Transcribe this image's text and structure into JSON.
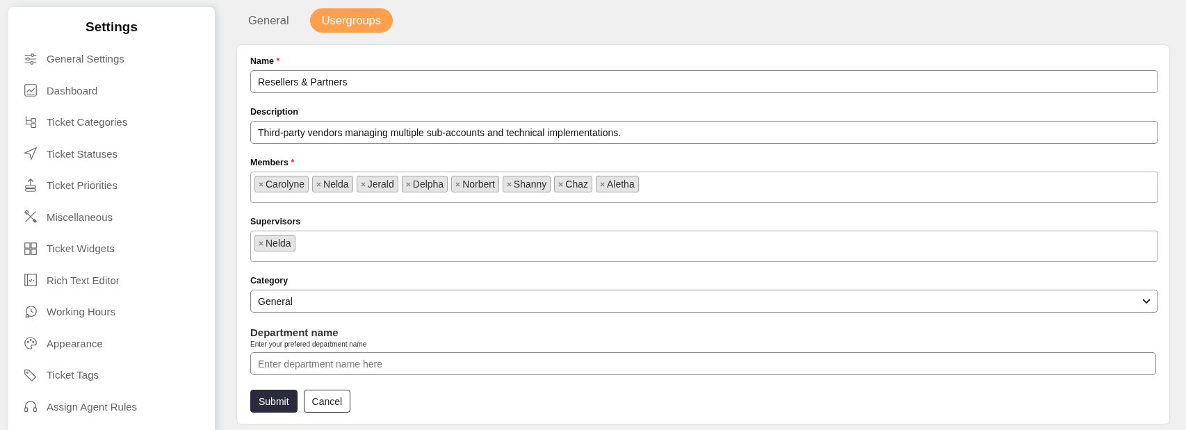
{
  "sidebar": {
    "title": "Settings",
    "items": [
      {
        "label": "General Settings"
      },
      {
        "label": "Dashboard"
      },
      {
        "label": "Ticket Categories"
      },
      {
        "label": "Ticket Statuses"
      },
      {
        "label": "Ticket Priorities"
      },
      {
        "label": "Miscellaneous"
      },
      {
        "label": "Ticket Widgets"
      },
      {
        "label": "Rich Text Editor"
      },
      {
        "label": "Working Hours"
      },
      {
        "label": "Appearance"
      },
      {
        "label": "Ticket Tags"
      },
      {
        "label": "Assign Agent Rules"
      }
    ]
  },
  "tabs": [
    {
      "label": "General",
      "selected": false
    },
    {
      "label": "Usergroups",
      "selected": true
    }
  ],
  "form": {
    "fields": [
      {
        "kind": "text",
        "label": "Name",
        "required_mark": "*",
        "value": "Resellers & Partners"
      },
      {
        "kind": "text",
        "label": "Description",
        "value": "Third-party vendors managing multiple sub-accounts and technical implementations."
      },
      {
        "kind": "tags",
        "label": "Members",
        "required_mark": "*",
        "tags": [
          "Carolyne",
          "Nelda",
          "Jerald",
          "Delpha",
          "Norbert",
          "Shanny",
          "Chaz",
          "Aletha"
        ]
      },
      {
        "kind": "tags",
        "label": "Supervisors",
        "tags": [
          "Nelda"
        ]
      },
      {
        "kind": "select",
        "label": "Category",
        "value": "General"
      },
      {
        "kind": "hinted-text",
        "label": "Department name",
        "hint": "Enter your prefered department name",
        "placeholder": "Enter department name here"
      }
    ],
    "buttons": [
      {
        "label": "Submit",
        "kind": "primary"
      },
      {
        "label": "Cancel",
        "kind": "secondary"
      }
    ]
  }
}
